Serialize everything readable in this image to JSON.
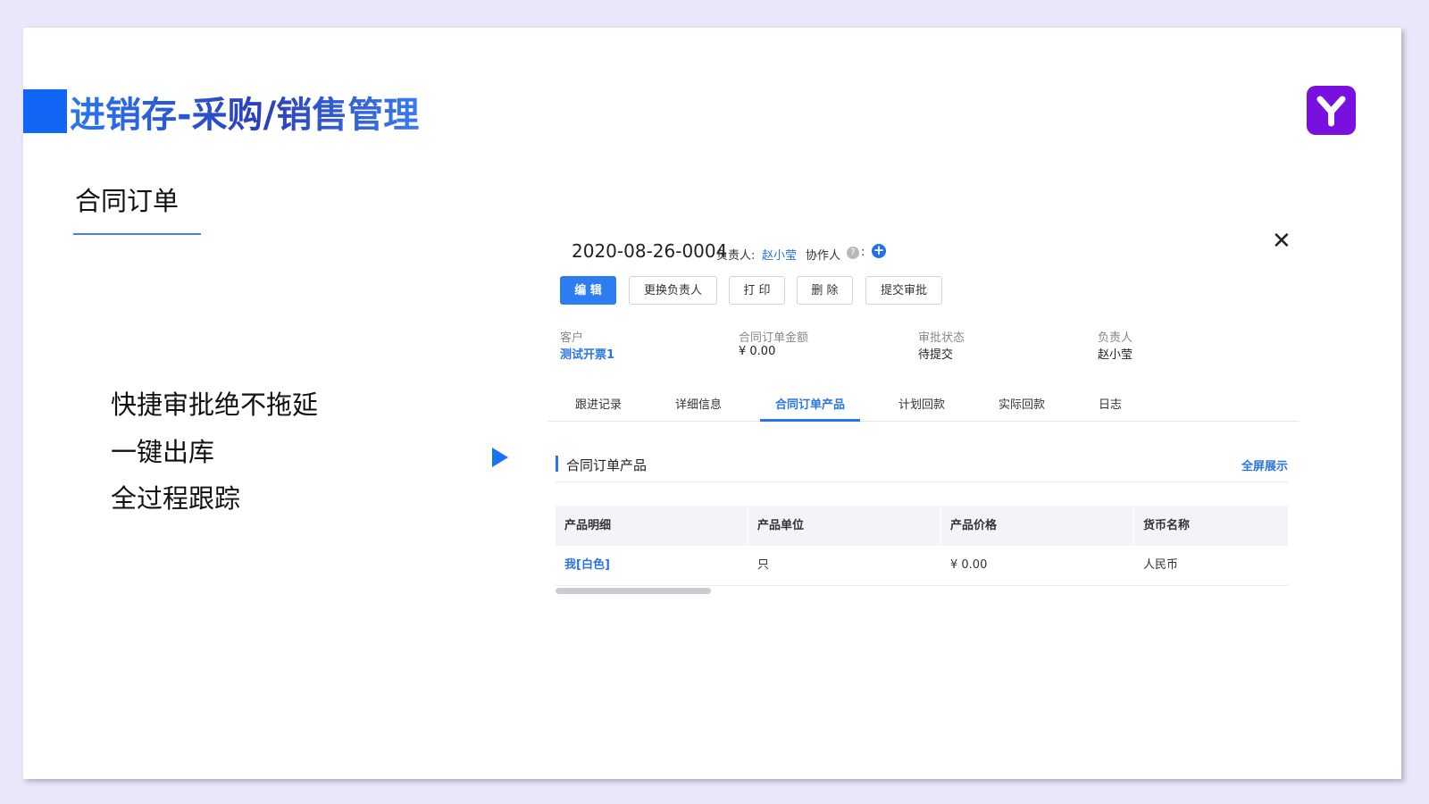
{
  "slide": {
    "title": "进销存-采购/销售管理",
    "subtitle": "合同订单",
    "features": [
      "快捷审批绝不拖延",
      "一键出库",
      "全过程跟踪"
    ]
  },
  "detail": {
    "order_no": "2020-08-26-0004",
    "owner_label": "负责人:",
    "owner_name": "赵小莹",
    "collab_label": "协作人",
    "collab_colon": ":",
    "help_glyph": "?",
    "plus_glyph": "+",
    "close_glyph": "✕",
    "buttons": {
      "edit": "编 辑",
      "change_owner": "更换负责人",
      "print": "打 印",
      "delete": "删 除",
      "submit_approval": "提交审批"
    },
    "info": [
      {
        "label": "客户",
        "value": "测试开票1"
      },
      {
        "label": "合同订单金额",
        "value": "¥ 0.00"
      },
      {
        "label": "审批状态",
        "value": "待提交"
      },
      {
        "label": "负责人",
        "value": "赵小莹"
      }
    ],
    "tabs": [
      "跟进记录",
      "详细信息",
      "合同订单产品",
      "计划回款",
      "实际回款",
      "日志"
    ],
    "active_tab": "合同订单产品",
    "section": {
      "title": "合同订单产品",
      "fullscreen": "全屏展示"
    },
    "table": {
      "headers": [
        "产品明细",
        "产品单位",
        "产品价格",
        "货币名称"
      ],
      "rows": [
        [
          "我[白色]",
          "只",
          "¥ 0.00",
          "人民币"
        ]
      ]
    }
  },
  "colors": {
    "accent": "#2b74e6",
    "primary_button": "#2d7cf0",
    "logo": "#7a10e0",
    "title_block": "#1166f6"
  }
}
